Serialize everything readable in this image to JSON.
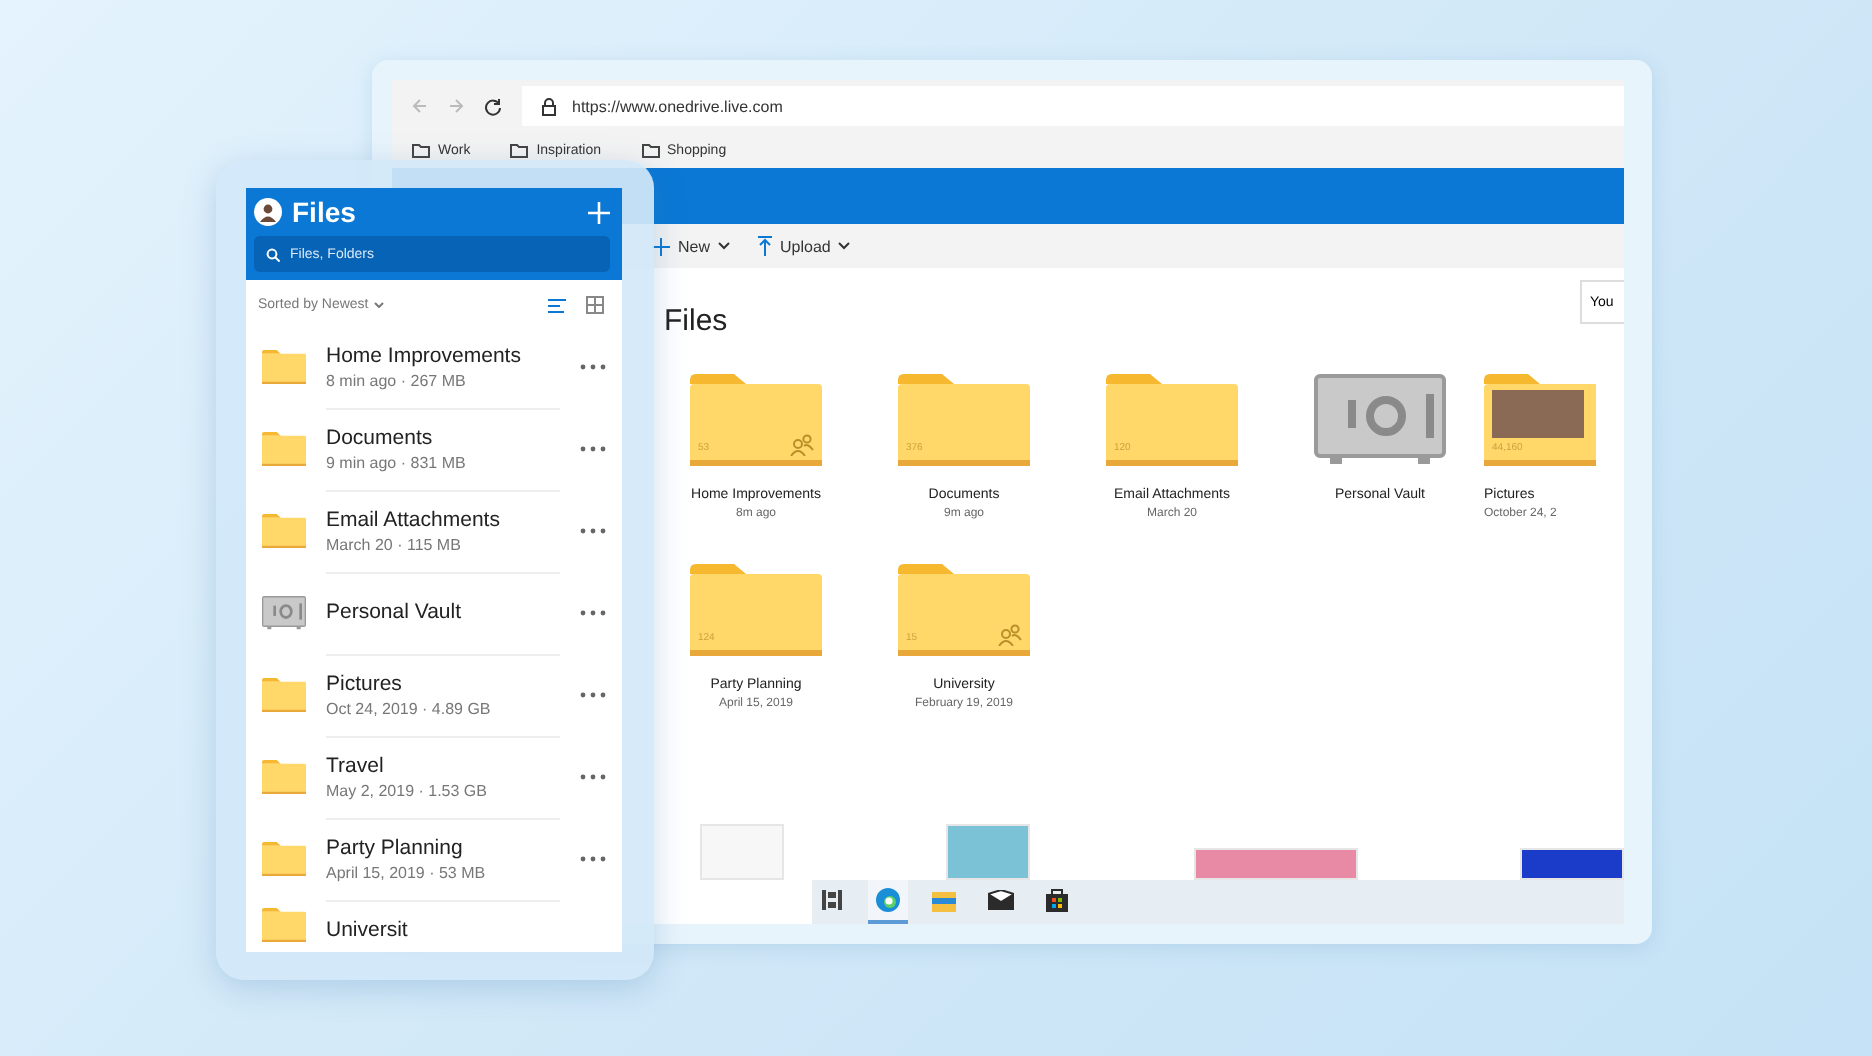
{
  "browser": {
    "url": "https://www.onedrive.live.com",
    "bookmarks": [
      "Work",
      "Inspiration",
      "Shopping"
    ],
    "toolbar": [
      "New",
      "Upload"
    ],
    "heading": "Files",
    "corner_button": "You",
    "folders": [
      {
        "kind": "folder",
        "name": "Home Improvements",
        "date": "8m ago",
        "count": "53",
        "shared": true
      },
      {
        "kind": "folder",
        "name": "Documents",
        "date": "9m ago",
        "count": "376",
        "shared": false
      },
      {
        "kind": "folder",
        "name": "Email Attachments",
        "date": "March 20",
        "count": "120",
        "shared": false
      },
      {
        "kind": "vault",
        "name": "Personal Vault"
      },
      {
        "kind": "photo-folder",
        "name": "Pictures",
        "date": "October 24, 2",
        "count": "44,160"
      },
      {
        "kind": "folder",
        "name": "Party Planning",
        "date": "April 15, 2019",
        "count": "124",
        "shared": false
      },
      {
        "kind": "folder",
        "name": "University",
        "date": "February 19, 2019",
        "count": "15",
        "shared": true
      }
    ],
    "taskbar": [
      {
        "kind": "task-view",
        "selected": false
      },
      {
        "kind": "browser",
        "selected": true
      },
      {
        "kind": "file-explorer",
        "selected": false
      },
      {
        "kind": "mail",
        "selected": false
      },
      {
        "kind": "store",
        "selected": false
      }
    ]
  },
  "phone": {
    "title": "Files",
    "search": {
      "placeholder": "Files, Folders"
    },
    "sort": "Sorted by Newest",
    "view": {
      "list_selected": true
    },
    "items": [
      {
        "kind": "folder",
        "name": "Home Improvements",
        "meta": "8 min ago · 267 MB"
      },
      {
        "kind": "folder",
        "name": "Documents",
        "meta": "9 min ago · 831 MB"
      },
      {
        "kind": "folder",
        "name": "Email Attachments",
        "meta": "March 20 · 115 MB"
      },
      {
        "kind": "vault",
        "name": "Personal Vault"
      },
      {
        "kind": "folder",
        "name": "Pictures",
        "meta": "Oct 24, 2019 · 4.89 GB"
      },
      {
        "kind": "folder",
        "name": "Travel",
        "meta": "May 2, 2019 · 1.53 GB"
      },
      {
        "kind": "folder",
        "name": "Party Planning",
        "meta": "April 15, 2019 · 53 MB"
      },
      {
        "kind": "folder",
        "name": "Universit"
      }
    ]
  }
}
